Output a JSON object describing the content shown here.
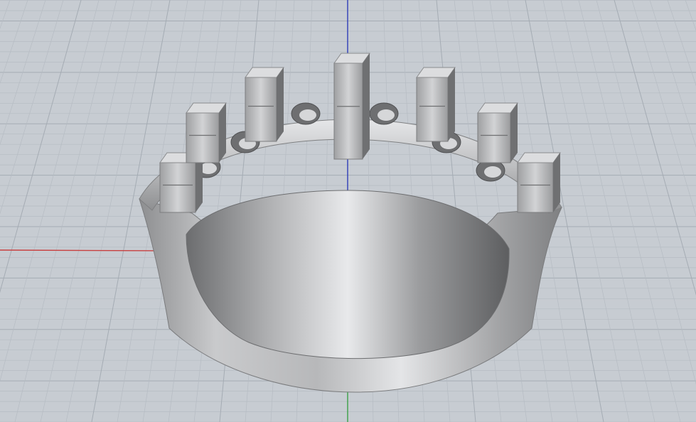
{
  "viewport": {
    "kind": "3D perspective viewport",
    "background_color": "#c7ccd2",
    "grid": {
      "visible": true,
      "minor_color": "#b6bcc3",
      "major_color": "#a5acb4"
    },
    "axes": {
      "x_axis_color": "#c84040",
      "y_axis_color": "#3aa046",
      "z_axis_color": "#2e3db8"
    }
  },
  "model": {
    "description_icon": "ring-with-prong-settings-icon",
    "material_color": "#a6a7a9",
    "highlight_color": "#dcdddf",
    "shadow_color": "#6f7072",
    "prong_count": 7,
    "stone_seat_count": 6
  }
}
